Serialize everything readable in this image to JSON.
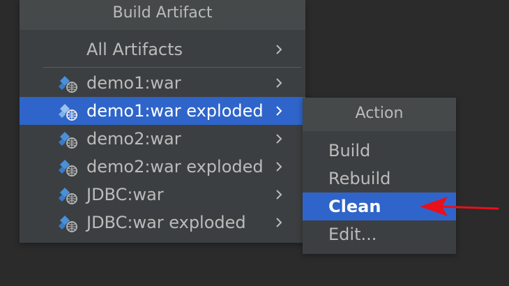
{
  "main_menu": {
    "title": "Build Artifact",
    "all_artifacts_label": "All Artifacts",
    "items": [
      {
        "label": "demo1:war"
      },
      {
        "label": "demo1:war exploded"
      },
      {
        "label": "demo2:war"
      },
      {
        "label": "demo2:war exploded"
      },
      {
        "label": "JDBC:war"
      },
      {
        "label": "JDBC:war exploded"
      }
    ],
    "selected_item": "demo1:war exploded"
  },
  "action_menu": {
    "title": "Action",
    "items": [
      {
        "label": "Build"
      },
      {
        "label": "Rebuild"
      },
      {
        "label": "Clean"
      },
      {
        "label": "Edit..."
      }
    ],
    "selected_item": "Clean"
  },
  "colors": {
    "selection": "#2f65ca",
    "menu_bg": "#3c3f41",
    "text": "#bbbbbb",
    "annotation_arrow": "#e8101a"
  },
  "icons": {
    "artifact": "web-artifact-icon",
    "submenu": "chevron-right-icon"
  }
}
